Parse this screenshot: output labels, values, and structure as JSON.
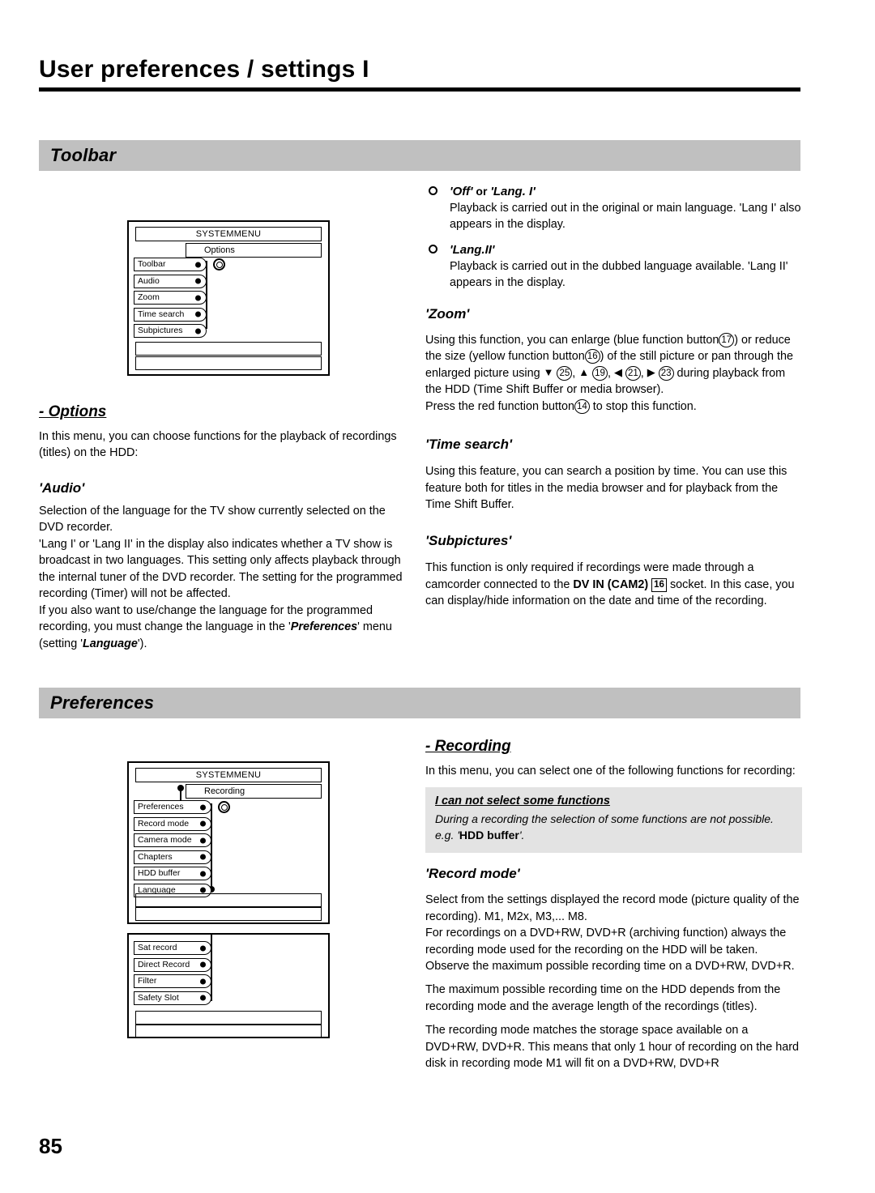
{
  "header": {
    "title": "User preferences / settings I"
  },
  "sections": {
    "toolbar_bar": "Toolbar",
    "preferences_bar": "Preferences"
  },
  "menu_options": {
    "title": "SYSTEMMENU",
    "subtitle": "Options",
    "items": [
      "Toolbar",
      "Audio",
      "Zoom",
      "Time search",
      "Subpictures"
    ]
  },
  "menu_recording": {
    "title": "SYSTEMMENU",
    "subtitle": "Recording",
    "items": [
      "Preferences",
      "Record mode",
      "Camera mode",
      "Chapters",
      "HDD buffer",
      "Language"
    ]
  },
  "menu_recording_2": {
    "items": [
      "Sat record",
      "Direct Record",
      "Filter",
      "Safety Slot"
    ]
  },
  "options": {
    "heading": "- Options",
    "intro": "In this menu, you can choose functions for the playback of recordings (titles) on the HDD:",
    "audio": {
      "heading": "'Audio'",
      "p1": "Selection of the language for the TV show currently selected on the DVD recorder.",
      "p2_a": "'Lang I' or 'Lang II' in the display also indicates whether a TV show is broadcast in two languages. This setting only affects playback through the internal tuner of the DVD recorder. The setting for the programmed recording (Timer) will not be affected.",
      "p3_a": "If you also want to use/change the language for the programmed recording, you must change the language in the '",
      "p3_b": "Preferences",
      "p3_c": "' menu (setting '",
      "p3_d": "Language",
      "p3_e": "')."
    }
  },
  "bullets": [
    {
      "title_a": "'Off'",
      "title_or": " or ",
      "title_b": "'Lang. I'",
      "body": "Playback is carried out in the original or main language. 'Lang I' also appears in the display."
    },
    {
      "title_a": "'Lang.II'",
      "title_or": "",
      "title_b": "",
      "body": "Playback is carried out in the dubbed language available. 'Lang II' appears in the display."
    }
  ],
  "zoom": {
    "heading": "'Zoom'",
    "t1": "Using this function, you can enlarge (blue function button",
    "k1": "17",
    "t2": ") or reduce the size (yellow function button",
    "k2": "16",
    "t3": ") of the still picture or pan through the enlarged picture using",
    "arrow_down": "▼",
    "k3": "25",
    "arrow_up": "▲",
    "k4": "19",
    "arrow_left": "◀",
    "k5": "21",
    "arrow_right": "▶",
    "k6": "23",
    "t4": "during playback from the HDD (Time Shift Buffer or media browser).",
    "t5": "Press the red function button",
    "k7": "14",
    "t6": "to stop this function."
  },
  "time_search": {
    "heading": "'Time search'",
    "body": "Using this feature, you can search a position by time. You can use this feature both for titles in the media browser and for playback from the Time Shift Buffer."
  },
  "subpictures": {
    "heading": "'Subpictures'",
    "t1": "This function is only required if recordings were made through a camcorder connected to the",
    "t2": "DV IN (CAM2)",
    "k1": "16",
    "t3": "socket. In this case, you can display/hide information on the date and time of the recording."
  },
  "recording": {
    "heading": "- Recording",
    "intro": "In this menu, you can select one of the following functions for recording:",
    "note_title": "I can not select some functions",
    "note_body_a": "During a recording the selection of some functions are not possible. e.g. '",
    "note_body_b": "HDD buffer",
    "note_body_c": "'.",
    "record_mode": {
      "heading": "'Record mode'",
      "p1": "Select from the settings displayed the record mode (picture quality of the recording). M1, M2x, M3,... M8.",
      "p2": "For recordings on a DVD+RW, DVD+R (archiving function) always the recording mode used for the recording on the HDD will be taken.",
      "p3": "Observe the maximum possible recording time on a DVD+RW, DVD+R.",
      "p4": "The maximum possible recording time on the HDD depends from the recording mode and the average length of the recordings (titles).",
      "p5": "The recording mode matches the storage space available on a DVD+RW, DVD+R. This means that only 1 hour of recording on the hard disk in recording mode M1 will fit on a DVD+RW, DVD+R"
    }
  },
  "footer": {
    "page_number": "85"
  }
}
